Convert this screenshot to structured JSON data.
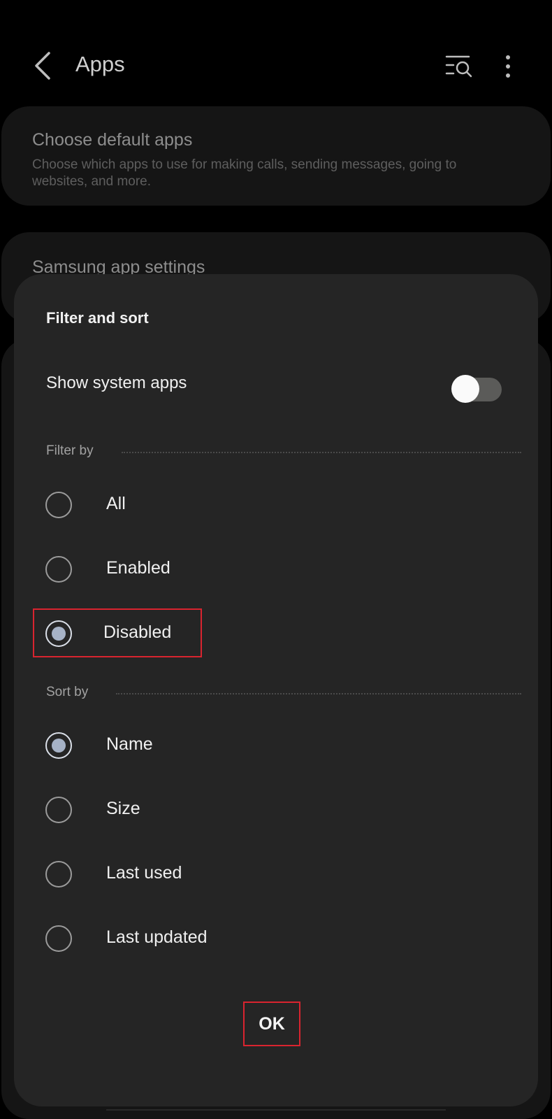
{
  "header": {
    "title": "Apps",
    "back_icon": "back-arrow-icon",
    "search_icon": "list-search-icon",
    "more_icon": "more-vertical-icon"
  },
  "cards": {
    "default_apps": {
      "title": "Choose default apps",
      "subtitle": "Choose which apps to use for making calls, sending messages, going to websites, and more."
    },
    "samsung": {
      "title": "Samsung app settings"
    }
  },
  "dialog": {
    "title": "Filter and sort",
    "show_system_apps": {
      "label": "Show system apps",
      "on": false
    },
    "filter_by": {
      "label": "Filter by",
      "options": [
        "All",
        "Enabled",
        "Disabled"
      ],
      "selected": "Disabled"
    },
    "sort_by": {
      "label": "Sort by",
      "options": [
        "Name",
        "Size",
        "Last used",
        "Last updated"
      ],
      "selected": "Name"
    },
    "ok_label": "OK"
  },
  "colors": {
    "background": "#000000",
    "card": "#151515",
    "dialog": "#252525",
    "radio_selected": "#a6b2c6",
    "highlight": "#d9242f"
  }
}
